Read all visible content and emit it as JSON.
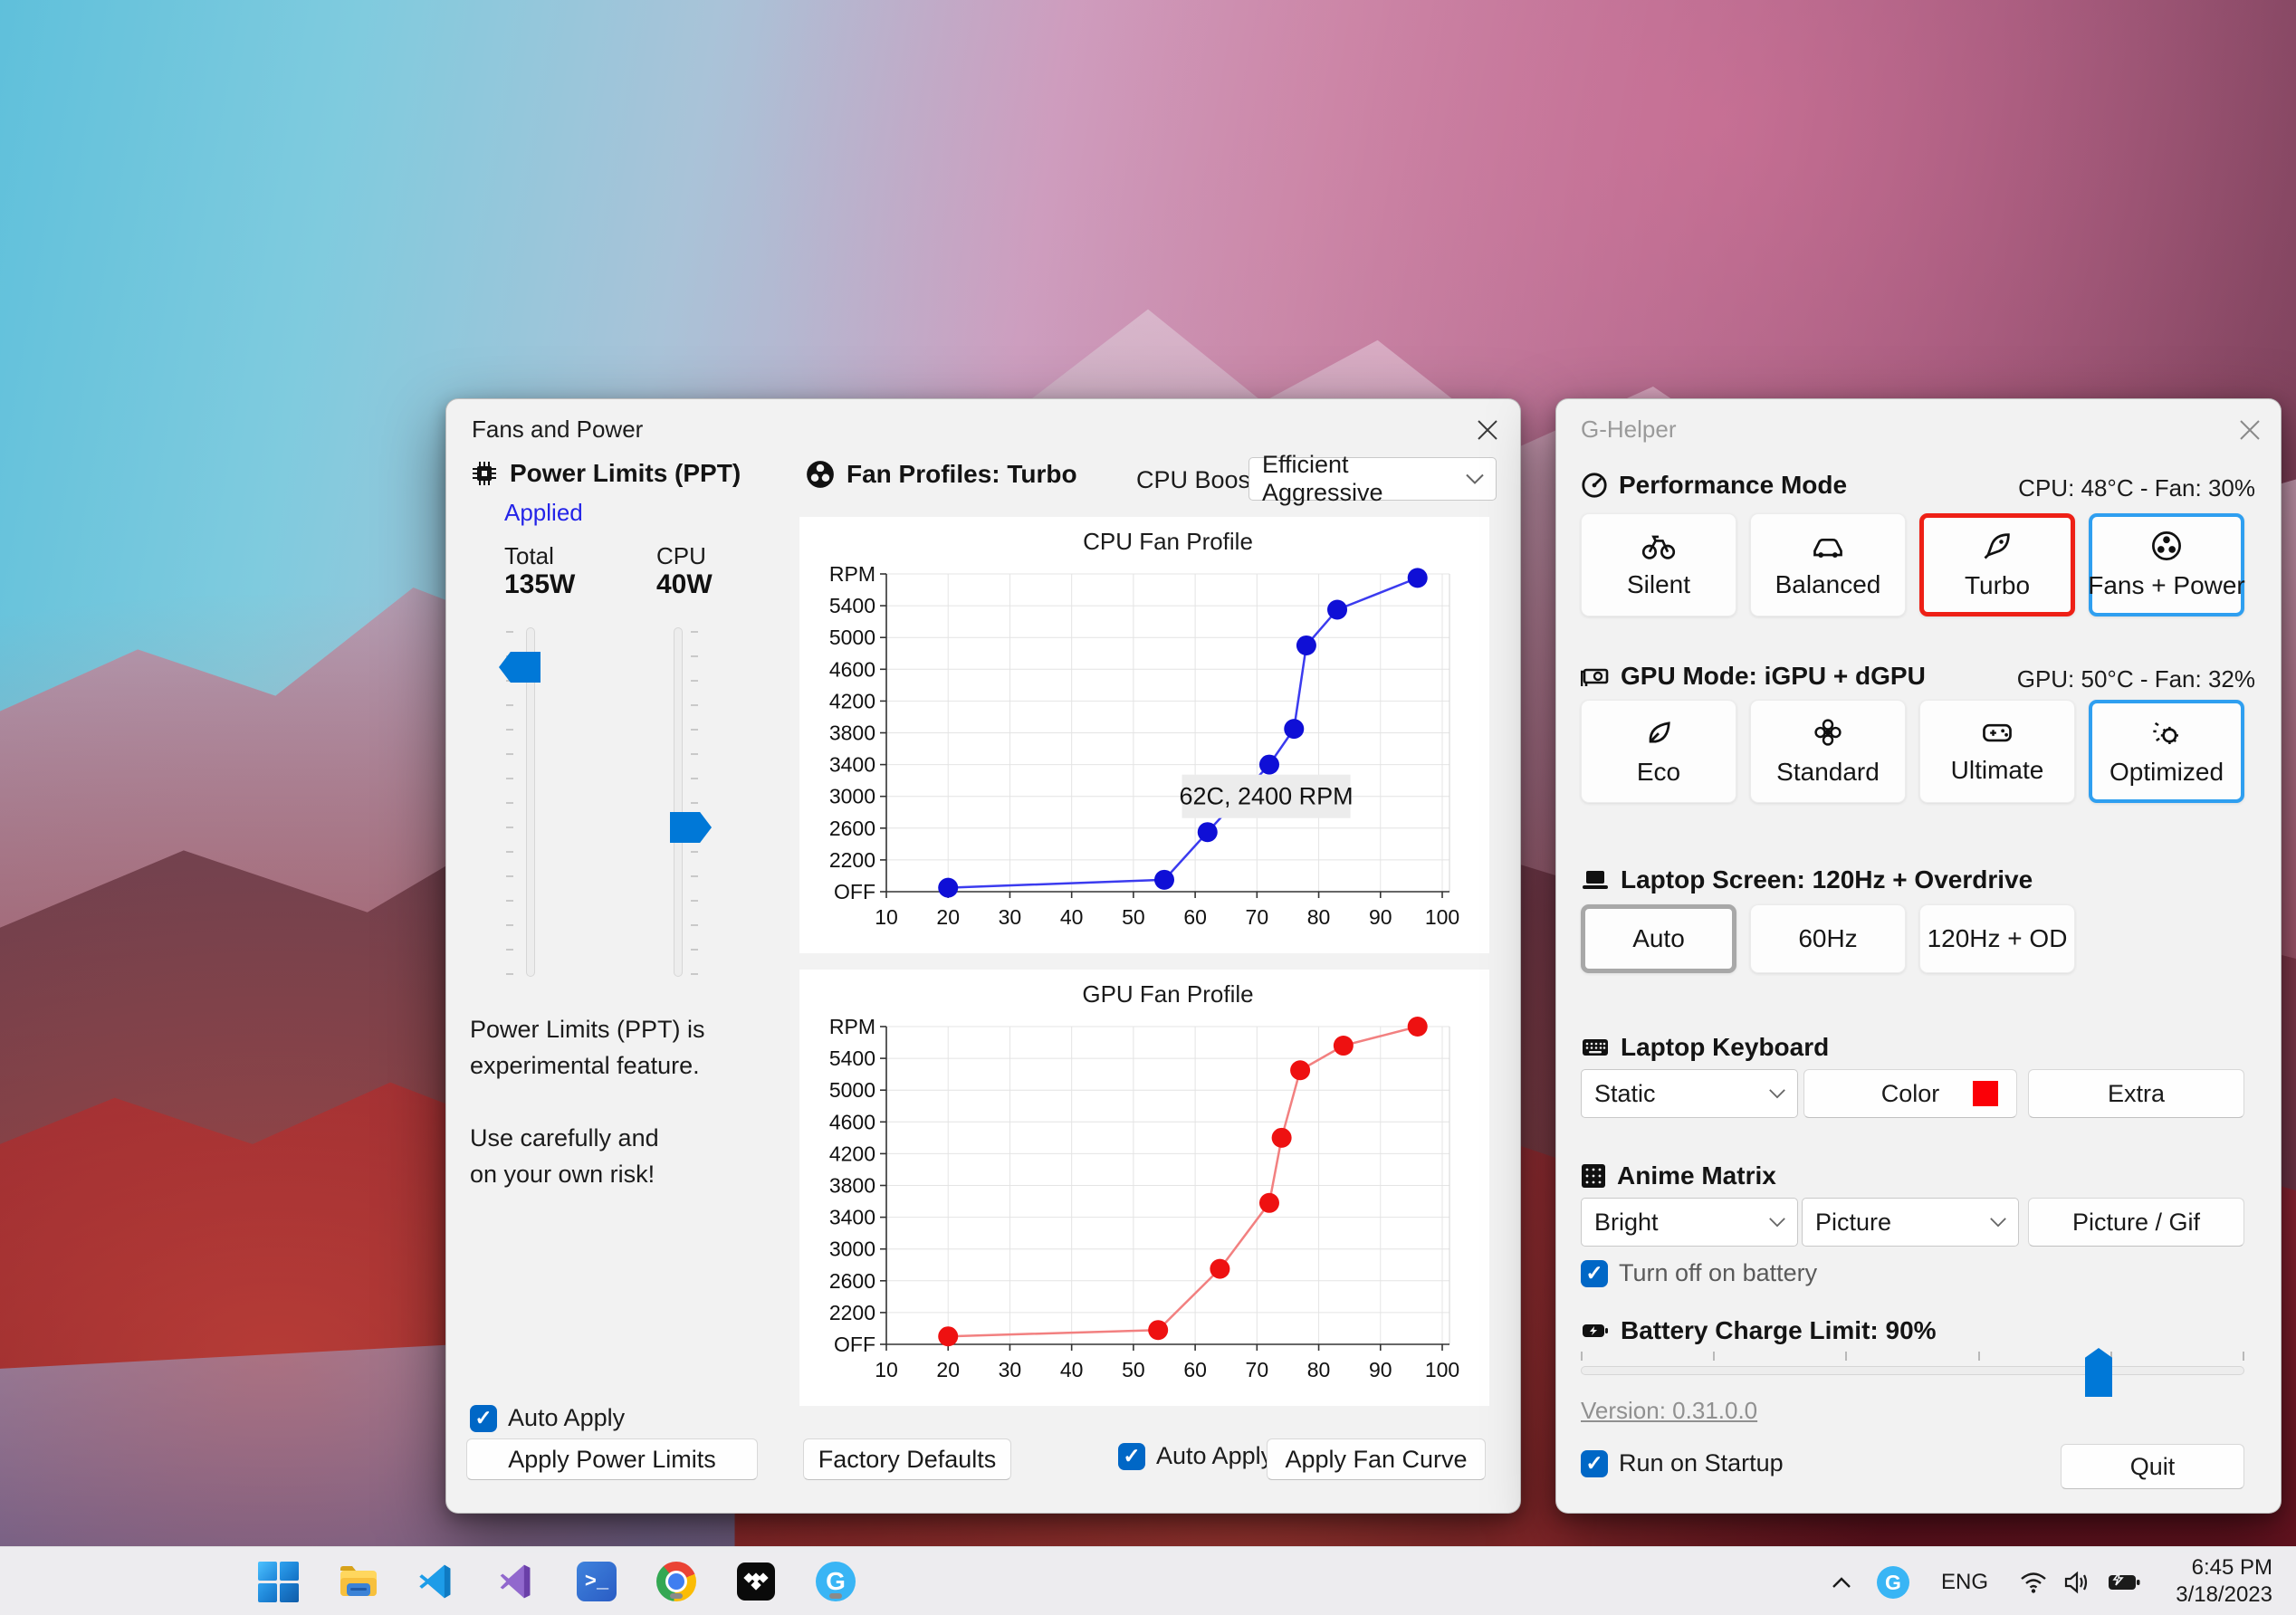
{
  "colors": {
    "accent_blue": "#0078d7",
    "checkbox_blue": "#0067c6",
    "selected_red_border": "#ee2016",
    "selected_blue_border": "#2f9ff0",
    "applied_link": "#2424e8",
    "keyboard_color_swatch": "#fb0007"
  },
  "fans_window": {
    "title": "Fans and Power",
    "power": {
      "heading": "Power Limits (PPT)",
      "applied": "Applied",
      "total_label": "Total",
      "total_value": "135W",
      "cpu_label": "CPU",
      "cpu_value": "40W",
      "warning1": "Power Limits (PPT) is",
      "warning2": "experimental feature.",
      "warning3": "Use carefully and",
      "warning4": "on your own risk!",
      "auto_apply": "Auto Apply",
      "apply_button": "Apply Power Limits"
    },
    "fans": {
      "heading": "Fan Profiles: Turbo",
      "cpu_boost_label": "CPU Boost",
      "cpu_boost_value": "Efficient Aggressive",
      "factory_button": "Factory Defaults",
      "auto_apply": "Auto Apply",
      "apply_button": "Apply Fan Curve"
    }
  },
  "g_helper": {
    "title": "G-Helper",
    "performance": {
      "heading": "Performance Mode",
      "status": "CPU: 48°C -  Fan: 30%",
      "modes": [
        {
          "label": "Silent"
        },
        {
          "label": "Balanced"
        },
        {
          "label": "Turbo"
        },
        {
          "label": "Fans + Power"
        }
      ]
    },
    "gpu": {
      "heading": "GPU Mode: iGPU + dGPU",
      "status": "GPU: 50°C -  Fan: 32%",
      "modes": [
        {
          "label": "Eco"
        },
        {
          "label": "Standard"
        },
        {
          "label": "Ultimate"
        },
        {
          "label": "Optimized"
        }
      ]
    },
    "screen": {
      "heading": "Laptop Screen: 120Hz + Overdrive",
      "options": [
        {
          "label": "Auto"
        },
        {
          "label": "60Hz"
        },
        {
          "label": "120Hz + OD"
        }
      ]
    },
    "keyboard": {
      "heading": "Laptop Keyboard",
      "mode_value": "Static",
      "color_button": "Color",
      "extra_button": "Extra"
    },
    "matrix": {
      "heading": "Anime Matrix",
      "brightness_value": "Bright",
      "mode_value": "Picture",
      "picture_button": "Picture / Gif",
      "battery_checkbox": "Turn off on battery"
    },
    "battery": {
      "heading": "Battery Charge Limit: 90%",
      "percent": 90
    },
    "version": "Version: 0.31.0.0",
    "startup_checkbox": "Run on Startup",
    "quit_button": "Quit"
  },
  "taskbar": {
    "language": "ENG",
    "time": "6:45 PM",
    "date": "3/18/2023",
    "apps": [
      "start",
      "explorer",
      "vscode",
      "visual-studio",
      "terminal",
      "chrome",
      "tidal",
      "g-helper"
    ]
  },
  "chart_data": [
    {
      "type": "line",
      "title": "CPU Fan Profile",
      "line_color": "#3b3bef",
      "point_color": "#0f0fd6",
      "x_ticks": [
        10,
        20,
        30,
        40,
        50,
        60,
        70,
        80,
        90,
        100
      ],
      "y_axis": {
        "off_value": 1800,
        "top_value": 5800,
        "step": 400,
        "off_label": "OFF",
        "top_label": "RPM"
      },
      "points": [
        [
          20,
          1850
        ],
        [
          55,
          1950
        ],
        [
          62,
          2550
        ],
        [
          72,
          3400
        ],
        [
          76,
          3850
        ],
        [
          78,
          4900
        ],
        [
          83,
          5350
        ],
        [
          96,
          5750
        ]
      ],
      "annotation": {
        "text": "62C, 2400 RPM",
        "x": 71.5,
        "y": 3000
      },
      "grid": true,
      "legend": "none"
    },
    {
      "type": "line",
      "title": "GPU Fan Profile",
      "line_color": "#f28080",
      "point_color": "#ee1111",
      "x_ticks": [
        10,
        20,
        30,
        40,
        50,
        60,
        70,
        80,
        90,
        100
      ],
      "y_axis": {
        "off_value": 1800,
        "top_value": 5800,
        "step": 400,
        "off_label": "OFF",
        "top_label": "RPM"
      },
      "points": [
        [
          20,
          1900
        ],
        [
          54,
          1980
        ],
        [
          64,
          2750
        ],
        [
          72,
          3580
        ],
        [
          74,
          4400
        ],
        [
          77,
          5250
        ],
        [
          84,
          5560
        ],
        [
          96,
          5800
        ]
      ],
      "grid": true,
      "legend": "none"
    }
  ]
}
